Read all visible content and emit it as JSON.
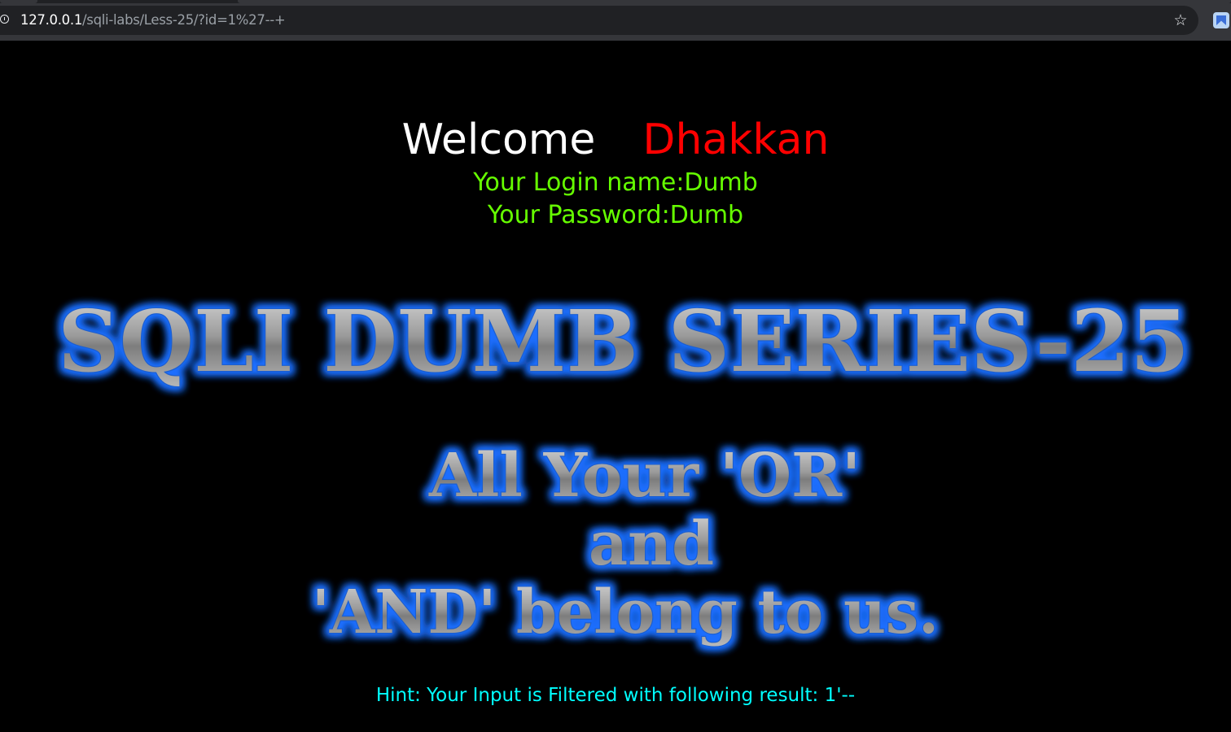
{
  "browser": {
    "url_host": "127.0.0.1",
    "url_path": "/sqli-labs/Less-25/?id=1%27--+",
    "site_info_icon": "info-icon",
    "bookmark_icon": "star-icon",
    "extension_icon": "extension-icon"
  },
  "welcome": {
    "greeting": "Welcome",
    "name": "Dhakkan",
    "greeting_color": "#ffffff",
    "name_color": "#ff0000"
  },
  "credentials": {
    "login_line": "Your Login name:Dumb",
    "password_line": "Your Password:Dumb",
    "color": "#66ff00"
  },
  "banner": {
    "title": "SQLI DUMB SERIES-25",
    "subtitle_line1": "All Your 'OR'",
    "subtitle_line2": "and",
    "subtitle_line3": "'AND' belong to us.",
    "glow_color": "#1e6fff"
  },
  "hint": {
    "text": "Hint: Your Input is Filtered with following result: 1'--",
    "color": "#00ffff"
  }
}
